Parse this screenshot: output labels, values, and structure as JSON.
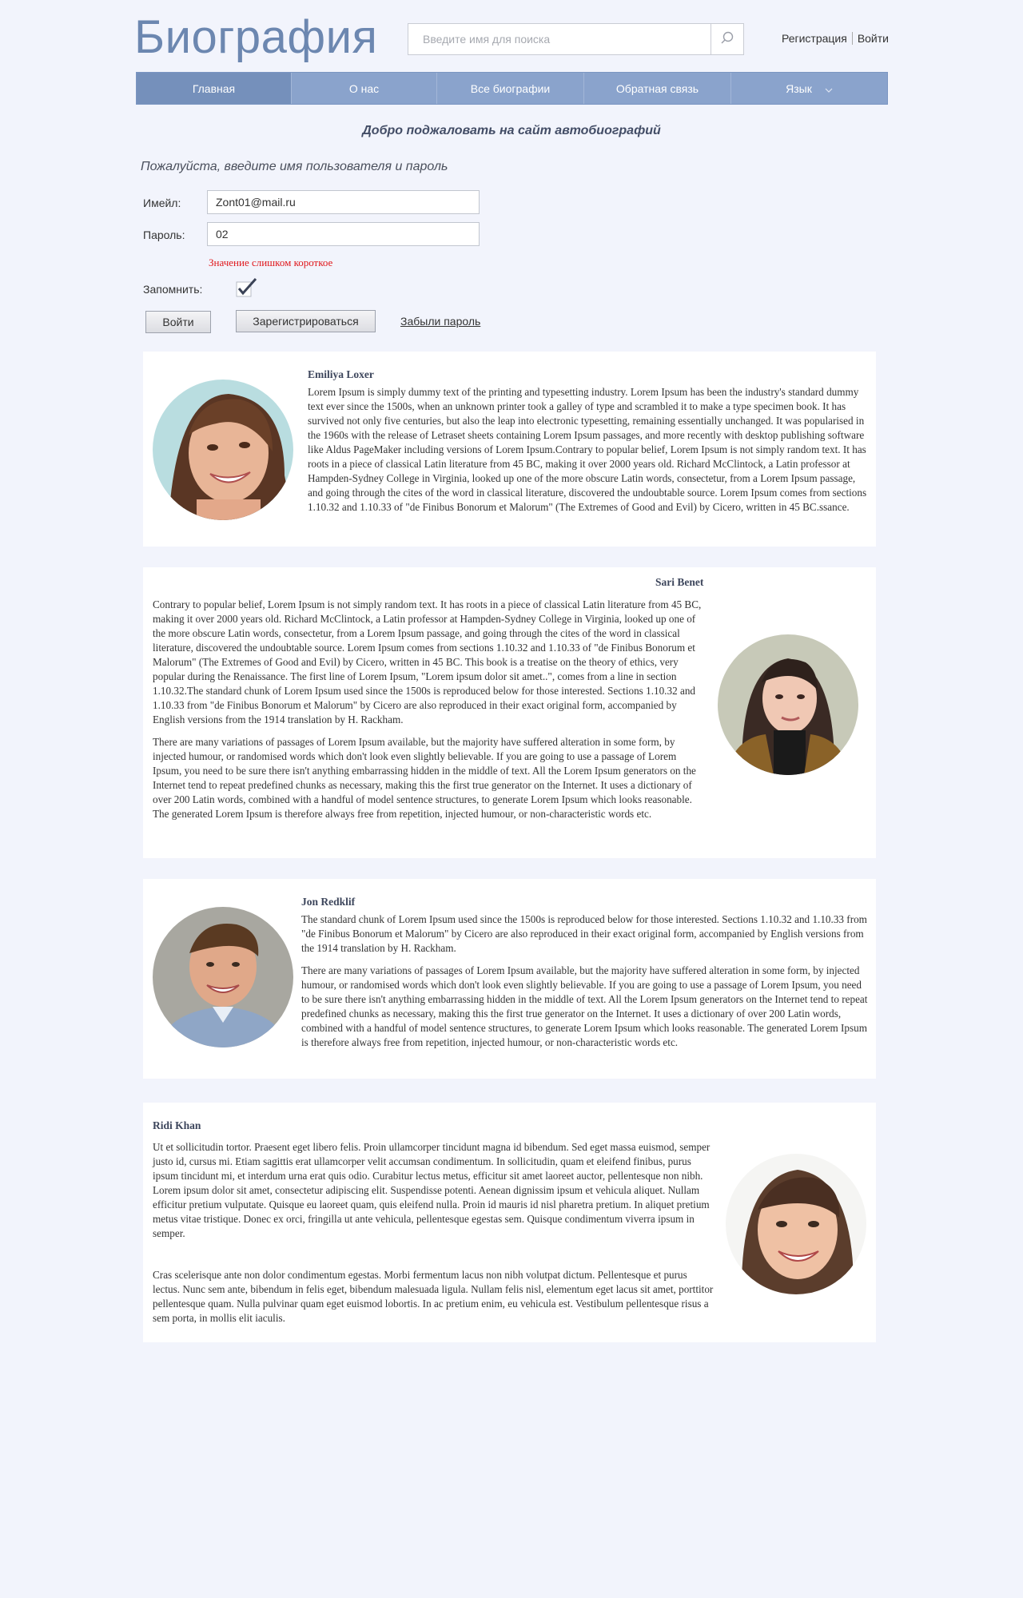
{
  "header": {
    "logo": "Биография",
    "search_placeholder": "Введите имя для поиска",
    "register_link": "Регистрация",
    "login_link": "Войти"
  },
  "nav": {
    "items": [
      {
        "label": "Главная",
        "active": true
      },
      {
        "label": "О нас"
      },
      {
        "label": "Все биографии"
      },
      {
        "label": "Обратная связь"
      },
      {
        "label": "Язык"
      }
    ]
  },
  "welcome": "Добро поджаловать на сайт автобиографий",
  "login_form": {
    "hint": "Пожалуйста, введите имя пользователя и пароль",
    "email_label": "Имейл:",
    "email_value": "Zont01@mail.ru",
    "password_label": "Пароль:",
    "password_value": "02",
    "error": "Значение слишком короткое",
    "remember_label": "Запомнить:",
    "remember_checked": true,
    "login_button": "Войти",
    "register_button": "Зарегистрироваться",
    "forgot_link": "Забыли пароль"
  },
  "biographies": [
    {
      "name": "Emiliya Loxer",
      "paragraphs": [
        "Lorem Ipsum is simply dummy text of the printing and typesetting industry. Lorem Ipsum has been the industry's standard dummy text ever since the 1500s, when an unknown printer took a galley of type and scrambled it to make a type specimen book. It has survived not only five centuries, but also the leap into electronic typesetting, remaining essentially unchanged. It was popularised in the 1960s with the release of Letraset sheets containing Lorem Ipsum passages, and more recently with desktop publishing software like Aldus PageMaker including versions of Lorem Ipsum.Contrary to popular belief, Lorem Ipsum is not simply random text. It has roots in a piece of classical Latin literature from 45 BC, making it over 2000 years old. Richard McClintock, a Latin professor at Hampden-Sydney College in Virginia, looked up one of the more obscure Latin words, consectetur, from a Lorem Ipsum passage, and going through the cites of the word in classical literature, discovered the undoubtable source. Lorem Ipsum comes from sections 1.10.32 and 1.10.33 of \"de Finibus Bonorum et Malorum\" (The Extremes of Good and Evil) by Cicero, written in 45 BC.ssance."
      ]
    },
    {
      "name": "Sari Benet",
      "paragraphs": [
        "Contrary to popular belief, Lorem Ipsum is not simply random text. It has roots in a piece of classical Latin literature from 45 BC, making it over 2000 years old. Richard McClintock, a Latin professor at Hampden-Sydney College in Virginia, looked up one of the more obscure Latin words, consectetur, from a Lorem Ipsum passage, and going through the cites of the word in classical literature, discovered the undoubtable source. Lorem Ipsum comes from sections 1.10.32 and 1.10.33 of \"de Finibus Bonorum et Malorum\" (The Extremes of Good and Evil) by Cicero, written in 45 BC. This book is a treatise on the theory of ethics, very popular during the Renaissance. The first line of Lorem Ipsum, \"Lorem ipsum dolor sit amet..\", comes from a line in section 1.10.32.The standard chunk of Lorem Ipsum used since the 1500s is reproduced below for those interested. Sections 1.10.32 and 1.10.33 from \"de Finibus Bonorum et Malorum\" by Cicero are also reproduced in their exact original form, accompanied by English versions from the 1914 translation by H. Rackham.",
        "There are many variations of passages of Lorem Ipsum available, but the majority have suffered alteration in some form, by injected humour, or randomised words which don't look even slightly believable. If you are going to use a passage of Lorem Ipsum, you need to be sure there isn't anything embarrassing hidden in the middle of text. All the Lorem Ipsum generators on the Internet tend to repeat predefined chunks as necessary, making this the first true generator on the Internet. It uses a dictionary of over 200 Latin words, combined with a handful of model sentence structures, to generate Lorem Ipsum which looks reasonable. The generated Lorem Ipsum is therefore always free from repetition, injected humour, or non-characteristic words etc."
      ]
    },
    {
      "name": "Jon Redklif",
      "paragraphs": [
        "The standard chunk of Lorem Ipsum used since the 1500s is reproduced below for those interested. Sections 1.10.32 and 1.10.33 from \"de Finibus Bonorum et Malorum\" by Cicero are also reproduced in their exact original form, accompanied by English versions from the 1914 translation by H. Rackham.",
        "There are many variations of passages of Lorem Ipsum available, but the majority have suffered alteration in some form, by injected humour, or randomised words which don't look even slightly believable. If you are going to use a passage of Lorem Ipsum, you need to be sure there isn't anything embarrassing hidden in the middle of text. All the Lorem Ipsum generators on the Internet tend to repeat predefined chunks as necessary, making this the first true generator on the Internet. It uses a dictionary of over 200 Latin words, combined with a handful of model sentence structures, to generate Lorem Ipsum which looks reasonable. The generated Lorem Ipsum is therefore always free from repetition, injected humour, or non-characteristic words etc."
      ]
    },
    {
      "name": "Ridi Khan",
      "paragraphs": [
        "Ut et sollicitudin tortor. Praesent eget libero felis. Proin ullamcorper tincidunt magna id bibendum. Sed eget massa euismod, semper justo id, cursus mi. Etiam sagittis erat ullamcorper velit accumsan condimentum. In sollicitudin, quam et eleifend finibus, purus ipsum tincidunt mi, et interdum urna erat quis odio. Curabitur lectus metus, efficitur sit amet laoreet auctor, pellentesque non nibh. Lorem ipsum dolor sit amet, consectetur adipiscing elit. Suspendisse potenti. Aenean dignissim ipsum et vehicula aliquet. Nullam efficitur pretium vulputate. Quisque eu laoreet quam, quis eleifend nulla. Proin id mauris id nisl pharetra pretium. In aliquet pretium metus vitae tristique. Donec ex orci, fringilla ut ante vehicula, pellentesque egestas sem. Quisque condimentum viverra ipsum in semper.",
        "Cras scelerisque ante non dolor condimentum egestas. Morbi fermentum lacus non nibh volutpat dictum. Pellentesque et purus lectus. Nunc sem ante, bibendum in felis eget, bibendum malesuada ligula. Nullam felis nisl, elementum eget lacus sit amet, porttitor pellentesque quam. Nulla pulvinar quam eget euismod lobortis. In ac pretium enim, eu vehicula est. Vestibulum pellentesque risus a sem porta, in mollis elit iaculis."
      ]
    }
  ],
  "colors": {
    "page_bg": "#f2f4fc",
    "logo": "#6c87b0",
    "nav_bg": "#8aa3cc",
    "nav_active": "#7590bb",
    "error": "#e0171b"
  },
  "icons": {
    "search": "search-icon",
    "checkbox": "checkmark-icon",
    "dropdown": "chevron-down-icon"
  }
}
